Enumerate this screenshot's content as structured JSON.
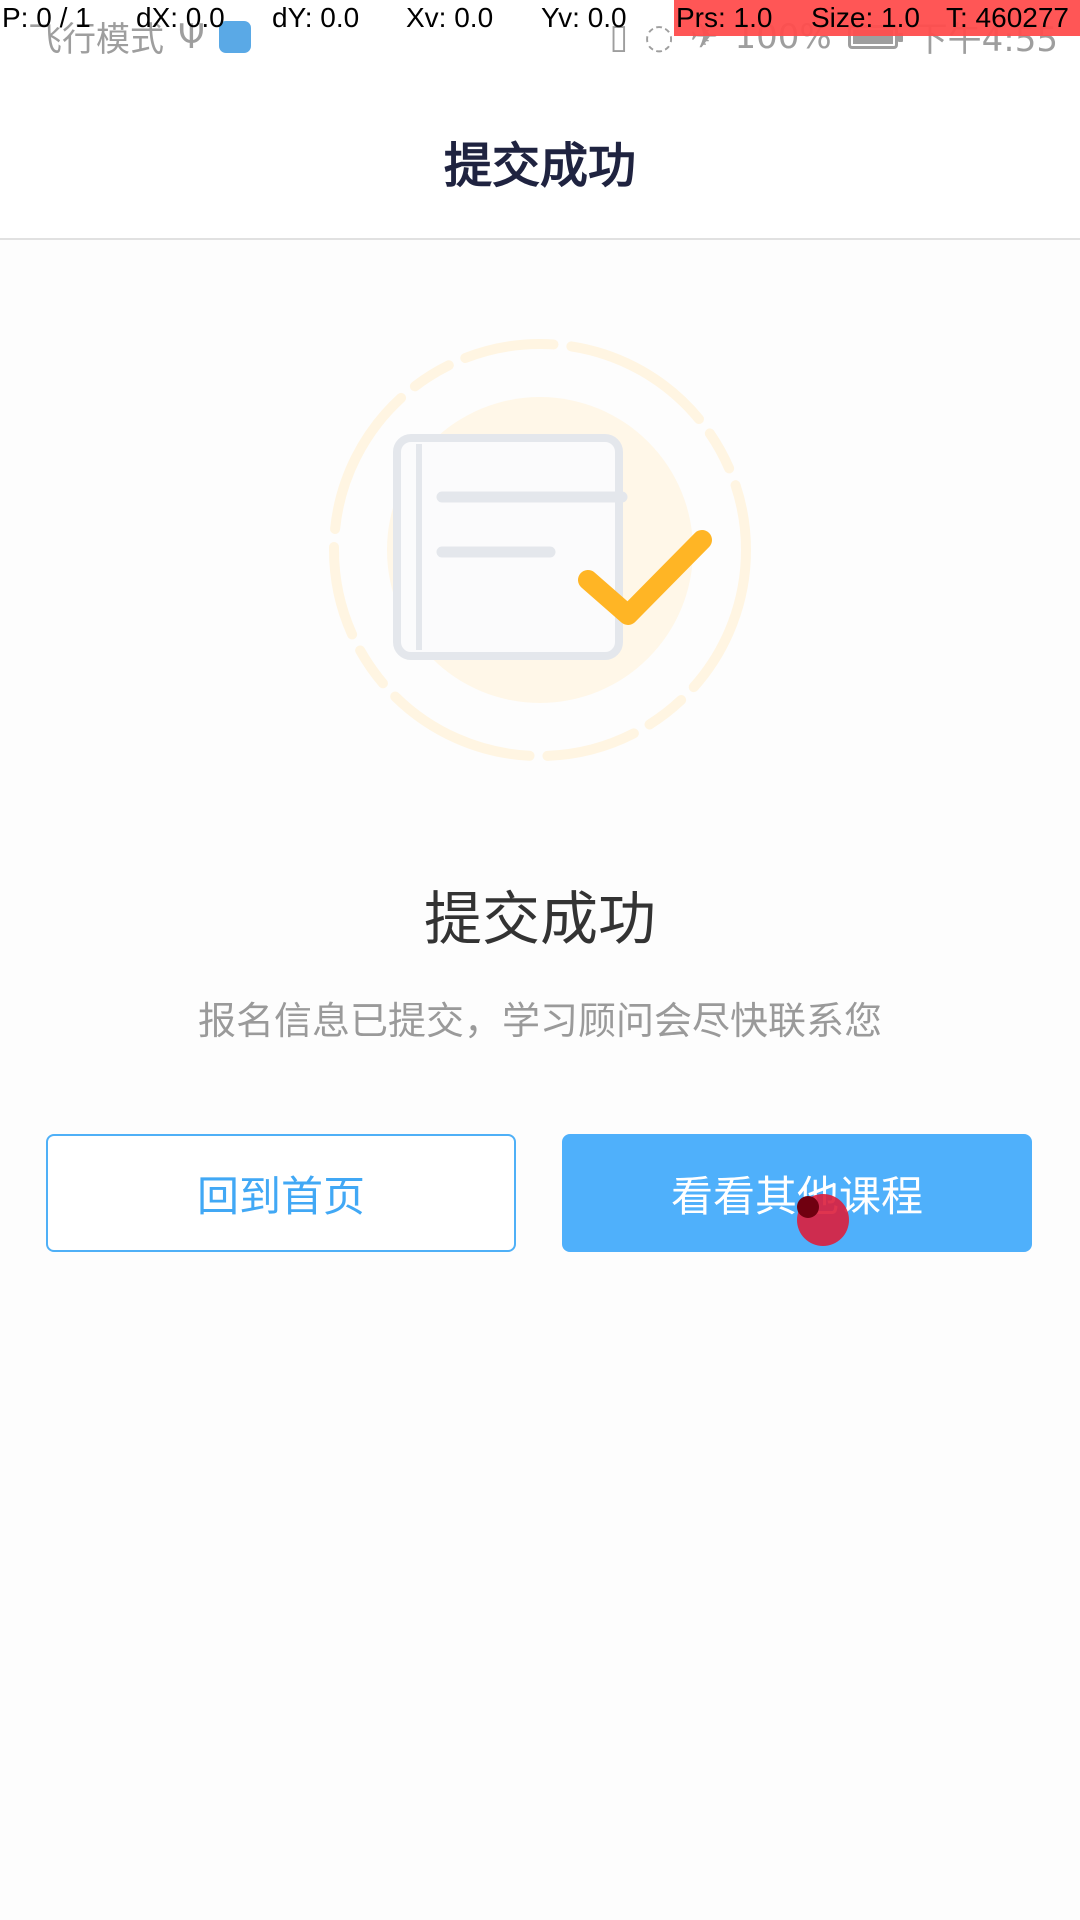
{
  "status_bar": {
    "carrier_text": "飞行模式",
    "usb_symbol": "Ψ",
    "battery_percent": "100%",
    "time": "下午4:55"
  },
  "debug_overlay": {
    "pointer": "P: 0 / 1",
    "dx": "dX: 0.0",
    "dy": "dY: 0.0",
    "xv": "Xv: 0.0",
    "yv": "Yv: 0.0",
    "prs": "Prs: 1.0",
    "size": "Size: 1.0",
    "t": "T: 460277"
  },
  "nav": {
    "title": "提交成功"
  },
  "illustration": {
    "icon": "document-checkmark-icon",
    "accent_color": "#ffb525",
    "doc_color": "#e4e7ec",
    "ring_color": "#fff6e4"
  },
  "result": {
    "title": "提交成功",
    "description": "报名信息已提交，学习顾问会尽快联系您"
  },
  "buttons": {
    "home_label": "回到首页",
    "courses_label": "看看其他课程"
  },
  "colors": {
    "primary": "#4fb0fb",
    "nav_title": "#1f2340"
  }
}
